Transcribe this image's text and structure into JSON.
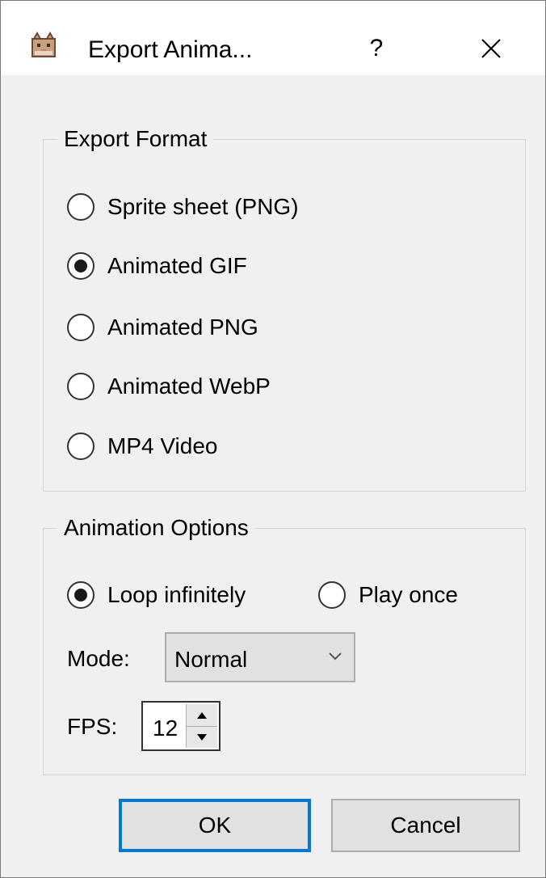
{
  "window": {
    "title": "Export Anima...",
    "help_label": "?",
    "app_icon": "cat-app-icon",
    "close_icon": "close-icon"
  },
  "export_format": {
    "legend": "Export Format",
    "options": [
      {
        "label": "Sprite sheet (PNG)",
        "checked": false
      },
      {
        "label": "Animated GIF",
        "checked": true
      },
      {
        "label": "Animated PNG",
        "checked": false
      },
      {
        "label": "Animated WebP",
        "checked": false
      },
      {
        "label": "MP4 Video",
        "checked": false
      }
    ]
  },
  "animation_options": {
    "legend": "Animation Options",
    "loop_label": "Loop infinitely",
    "loop_checked": true,
    "once_label": "Play once",
    "once_checked": false,
    "mode_label": "Mode:",
    "mode_value": "Normal",
    "fps_label": "FPS:",
    "fps_value": "12"
  },
  "buttons": {
    "ok": "OK",
    "cancel": "Cancel"
  },
  "colors": {
    "focus_border": "#0078d7",
    "dialog_bg": "#f0f0f0"
  }
}
